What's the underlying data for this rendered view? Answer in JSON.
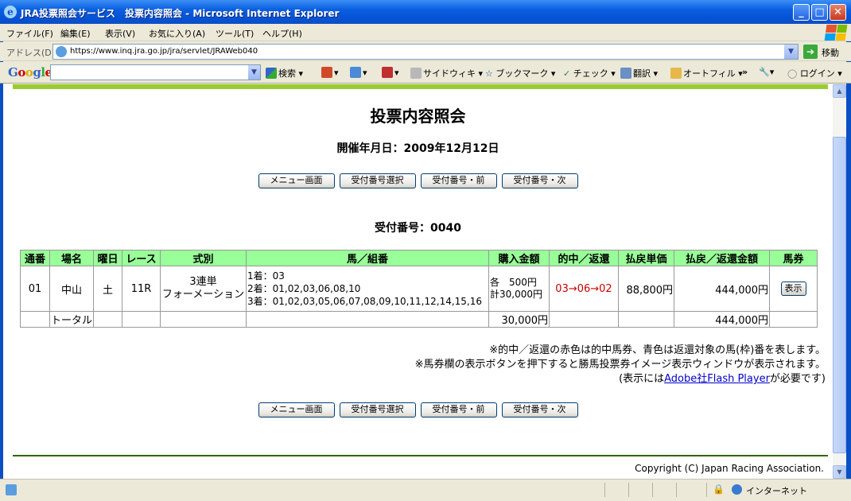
{
  "window": {
    "title": "JRA投票照会サービス　投票内容照会 - Microsoft Internet Explorer",
    "minimize": "_",
    "maximize": "□",
    "close": "✕"
  },
  "menu": [
    "ファイル(F)",
    "編集(E)",
    "表示(V)",
    "お気に入り(A)",
    "ツール(T)",
    "ヘルプ(H)"
  ],
  "address": {
    "label": "アドレス(D)",
    "url": "https://www.inq.jra.go.jp/jra/servlet/JRAWeb040",
    "go_label": "移動"
  },
  "google_toolbar": {
    "logo": "Google",
    "items": [
      "検索 ▾",
      "▾",
      "▾",
      "▾",
      "サイドウィキ ▾",
      "ブックマーク ▾",
      "チェック ▾",
      "翻訳 ▾",
      "オートフィル ▾",
      "»",
      "▾",
      "ログイン ▾"
    ],
    "colors": {
      "google_blue": "#3366cc",
      "google_red": "#cc0000",
      "google_yellow": "#ddaa00",
      "google_green": "#33aa33"
    }
  },
  "page": {
    "title": "投票内容照会",
    "race_date": "開催年月日：2009年12月12日",
    "nav_buttons": [
      "メニュー画面",
      "受付番号選択",
      "受付番号・前",
      "受付番号・次"
    ],
    "receipt_number": "受付番号：0040",
    "table": {
      "headers": [
        "通番",
        "場名",
        "曜日",
        "レース",
        "式別",
        "馬／組番",
        "購入金額",
        "的中／返還",
        "払戻単価",
        "払戻／返還金額",
        "馬券"
      ],
      "rows": [
        {
          "serial": "01",
          "venue": "中山",
          "weekday": "土",
          "race": "11R",
          "bet_type_1": "3連単",
          "bet_type_2": "フォーメーション",
          "horses": [
            "1着：03",
            "2着：01,02,03,06,08,10",
            "3着：01,02,03,05,06,07,08,09,10,11,12,14,15,16"
          ],
          "amount_each": "各　500円",
          "amount_total": "計30,000円",
          "result": "03→06→02",
          "unit_payout": "88,800円",
          "payout": "444,000円",
          "ticket_button": "表示"
        }
      ],
      "total": {
        "label": "トータル",
        "amount": "30,000円",
        "payout": "444,000円"
      }
    },
    "notes": {
      "line1": "※的中／返還の赤色は的中馬券、青色は返還対象の馬(枠)番を表します。",
      "line2": "※馬券欄の表示ボタンを押下すると勝馬投票券イメージ表示ウィンドウが表示されます。",
      "line3_pre": "(表示には",
      "line3_link": "Adobe社Flash Player",
      "line3_post": "が必要です)"
    },
    "copyright": "Copyright (C) Japan Racing Association."
  },
  "statusbar": {
    "zone": "インターネット"
  },
  "colors": {
    "header_bg": "#99ff99",
    "hit_red": "#cc0000",
    "top_rule": "#99cc33",
    "footer_rule": "#336600",
    "link": "#0000cc"
  }
}
